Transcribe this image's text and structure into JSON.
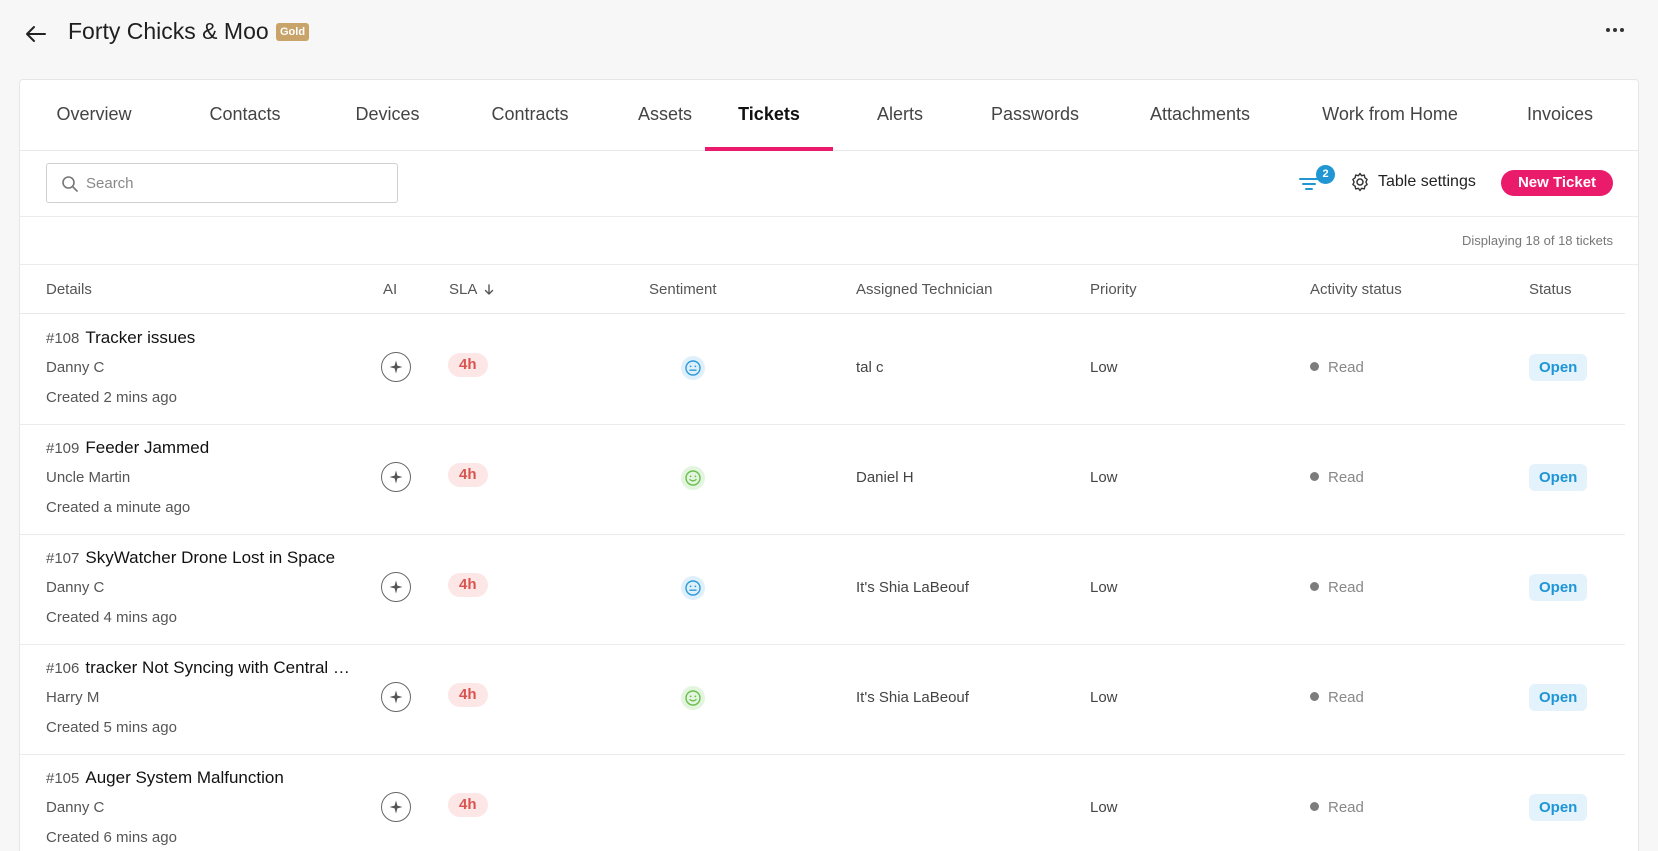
{
  "header": {
    "title": "Forty Chicks & Moo",
    "tier_badge": "Gold",
    "back_icon": "arrow-left-icon",
    "more_icon": "ellipsis-icon"
  },
  "tabs": [
    {
      "label": "Overview",
      "active": false
    },
    {
      "label": "Contacts",
      "active": false
    },
    {
      "label": "Devices",
      "active": false
    },
    {
      "label": "Contracts",
      "active": false
    },
    {
      "label": "Assets",
      "active": false
    },
    {
      "label": "Tickets",
      "active": true
    },
    {
      "label": "Alerts",
      "active": false
    },
    {
      "label": "Passwords",
      "active": false
    },
    {
      "label": "Attachments",
      "active": false
    },
    {
      "label": "Work from Home",
      "active": false
    },
    {
      "label": "Invoices",
      "active": false
    }
  ],
  "toolbar": {
    "search_placeholder": "Search",
    "filter_count": "2",
    "table_settings_label": "Table settings",
    "new_ticket_label": "New Ticket"
  },
  "display_count": "Displaying 18 of 18 tickets",
  "columns": {
    "details": "Details",
    "ai": "AI",
    "sla": "SLA",
    "sentiment": "Sentiment",
    "technician": "Assigned Technician",
    "priority": "Priority",
    "activity": "Activity status",
    "status": "Status"
  },
  "colors": {
    "accent": "#ea1b6b",
    "sla_text": "#d9534f",
    "status_text": "#1e95d6",
    "gold": "#c9a46a"
  },
  "tickets": [
    {
      "number": "#108",
      "subject": "Tracker issues",
      "contact": "Danny C",
      "created": "Created 2 mins ago",
      "sla": "4h",
      "sentiment": "neutral",
      "technician": "tal c",
      "priority": "Low",
      "activity": "Read",
      "status": "Open"
    },
    {
      "number": "#109",
      "subject": "Feeder Jammed",
      "contact": "Uncle Martin",
      "created": "Created a minute ago",
      "sla": "4h",
      "sentiment": "positive",
      "technician": "Daniel H",
      "priority": "Low",
      "activity": "Read",
      "status": "Open"
    },
    {
      "number": "#107",
      "subject": "SkyWatcher Drone Lost in Space",
      "contact": "Danny C",
      "created": "Created 4 mins ago",
      "sla": "4h",
      "sentiment": "neutral",
      "technician": "It's Shia LaBeouf",
      "priority": "Low",
      "activity": "Read",
      "status": "Open"
    },
    {
      "number": "#106",
      "subject": "tracker Not Syncing with Central …",
      "contact": "Harry M",
      "created": "Created 5 mins ago",
      "sla": "4h",
      "sentiment": "positive",
      "technician": "It's Shia LaBeouf",
      "priority": "Low",
      "activity": "Read",
      "status": "Open"
    },
    {
      "number": "#105",
      "subject": "Auger System Malfunction",
      "contact": "Danny C",
      "created": "Created 6 mins ago",
      "sla": "4h",
      "sentiment": "",
      "technician": "",
      "priority": "Low",
      "activity": "Read",
      "status": "Open"
    }
  ]
}
